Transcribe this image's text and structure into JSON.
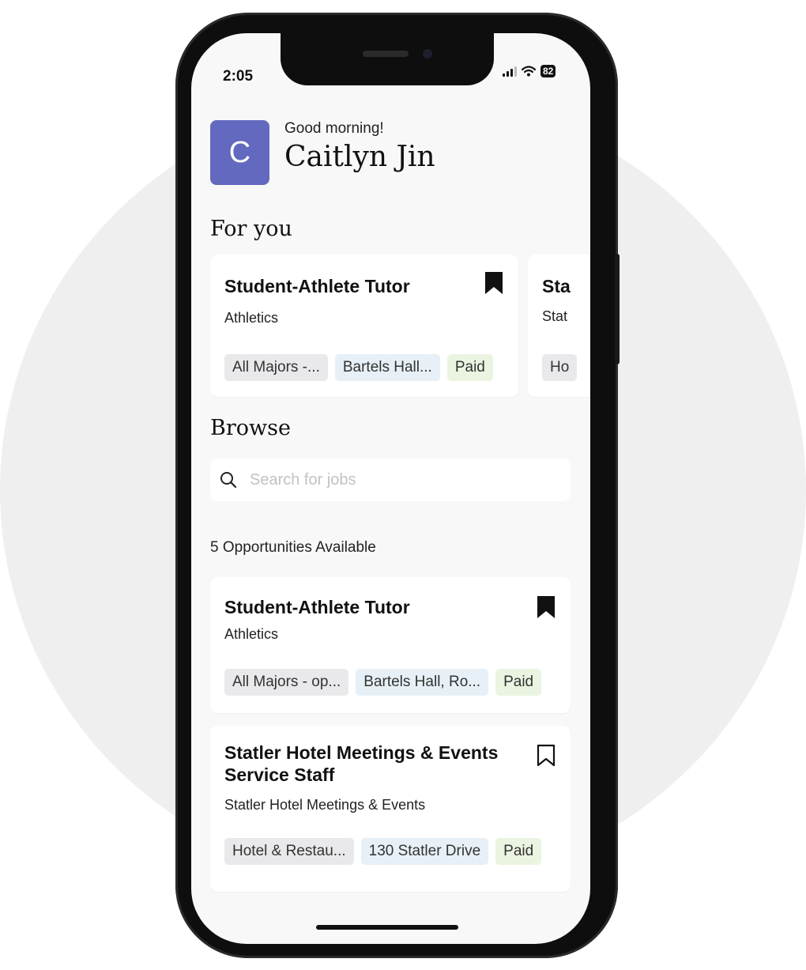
{
  "status": {
    "time": "2:05",
    "battery": "82"
  },
  "profile": {
    "avatar_letter": "C",
    "greeting": "Good morning!",
    "name": "Caitlyn Jin"
  },
  "for_you": {
    "title": "For you",
    "cards": [
      {
        "title": "Student-Athlete Tutor",
        "subtitle": "Athletics",
        "tags": [
          "All Majors -...",
          "Bartels Hall...",
          "Paid"
        ],
        "saved": true
      },
      {
        "title": "Sta",
        "subtitle": "Stat",
        "tags": [
          "Ho"
        ]
      }
    ]
  },
  "browse": {
    "title": "Browse",
    "search_placeholder": "Search for jobs",
    "count_label": "5 Opportunities Available",
    "jobs": [
      {
        "title": "Student-Athlete Tutor",
        "subtitle": "Athletics",
        "tags": [
          "All Majors - op...",
          "Bartels Hall, Ro...",
          "Paid"
        ],
        "saved": true
      },
      {
        "title_line1": "Statler Hotel Meetings & Events",
        "title_line2": "Service Staff",
        "subtitle": "Statler Hotel Meetings & Events",
        "tags": [
          "Hotel & Restau...",
          "130 Statler Drive",
          "Paid"
        ],
        "saved": false
      }
    ]
  },
  "colors": {
    "avatar": "#6369bf",
    "tag_gray": "#e9e9eb",
    "tag_blue": "#e7f0f6",
    "tag_green": "#eaf4e1"
  },
  "icons": {
    "bookmark_filled": "bookmark-filled-icon",
    "bookmark_outline": "bookmark-outline-icon",
    "search": "search-icon"
  }
}
